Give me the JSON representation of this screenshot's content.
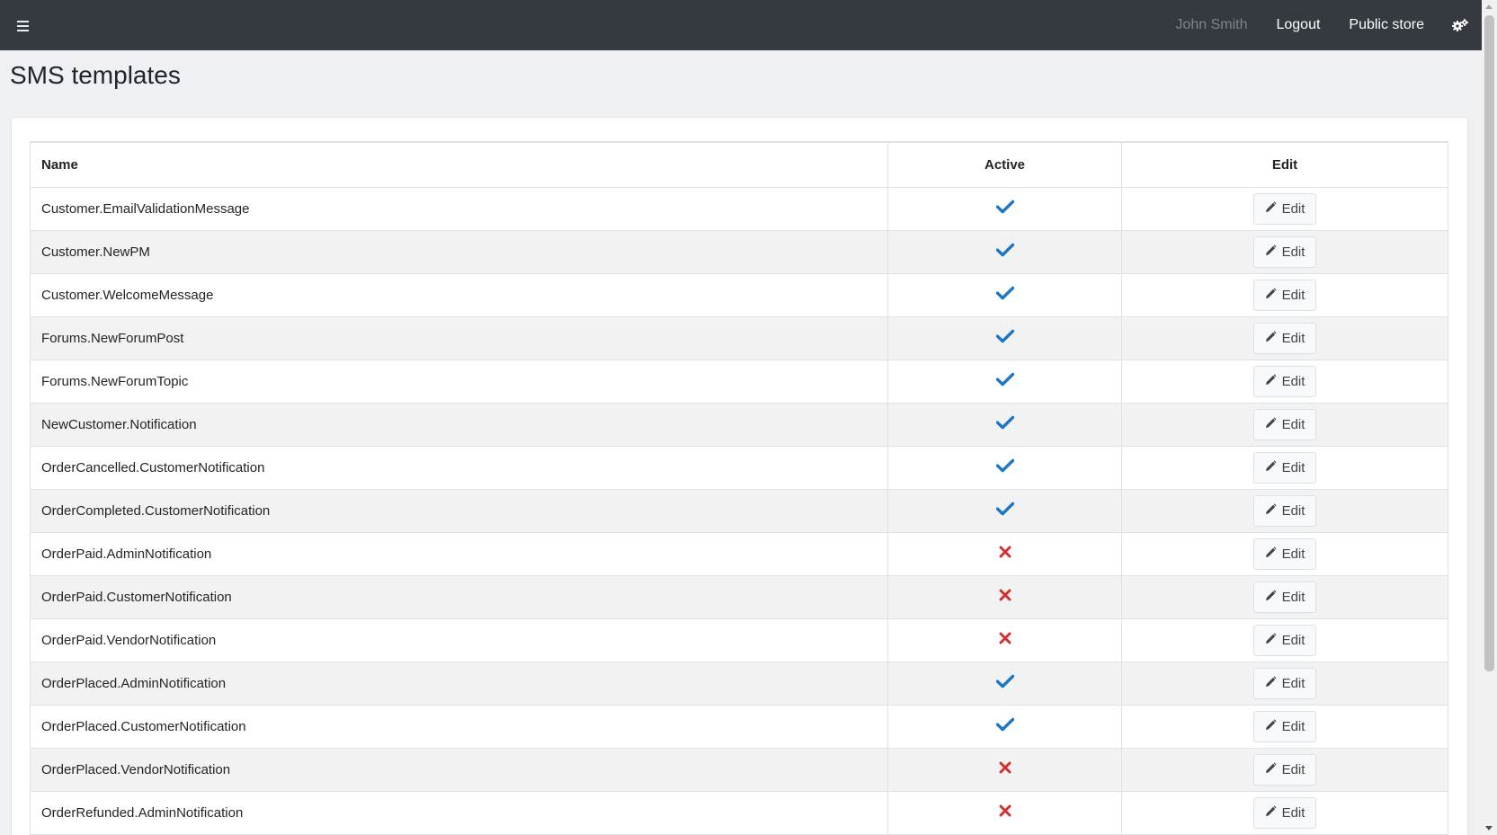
{
  "topbar": {
    "user_name": "John Smith",
    "logout_label": "Logout",
    "public_store_label": "Public store"
  },
  "page": {
    "title": "SMS templates"
  },
  "table": {
    "headers": {
      "name": "Name",
      "active": "Active",
      "edit": "Edit"
    },
    "edit_label": "Edit",
    "rows": [
      {
        "name": "Customer.EmailValidationMessage",
        "active": true
      },
      {
        "name": "Customer.NewPM",
        "active": true
      },
      {
        "name": "Customer.WelcomeMessage",
        "active": true
      },
      {
        "name": "Forums.NewForumPost",
        "active": true
      },
      {
        "name": "Forums.NewForumTopic",
        "active": true
      },
      {
        "name": "NewCustomer.Notification",
        "active": true
      },
      {
        "name": "OrderCancelled.CustomerNotification",
        "active": true
      },
      {
        "name": "OrderCompleted.CustomerNotification",
        "active": true
      },
      {
        "name": "OrderPaid.AdminNotification",
        "active": false
      },
      {
        "name": "OrderPaid.CustomerNotification",
        "active": false
      },
      {
        "name": "OrderPaid.VendorNotification",
        "active": false
      },
      {
        "name": "OrderPlaced.AdminNotification",
        "active": true
      },
      {
        "name": "OrderPlaced.CustomerNotification",
        "active": true
      },
      {
        "name": "OrderPlaced.VendorNotification",
        "active": false
      },
      {
        "name": "OrderRefunded.AdminNotification",
        "active": false
      }
    ]
  },
  "colors": {
    "topbar": "#343a40",
    "check": "#1d74c5",
    "cross": "#d32f2f",
    "background": "#eef0f3"
  },
  "icons": {
    "menu": "hamburger-icon",
    "settings": "gears-icon",
    "active_true": "check-icon",
    "active_false": "x-icon",
    "edit": "pencil-icon"
  }
}
